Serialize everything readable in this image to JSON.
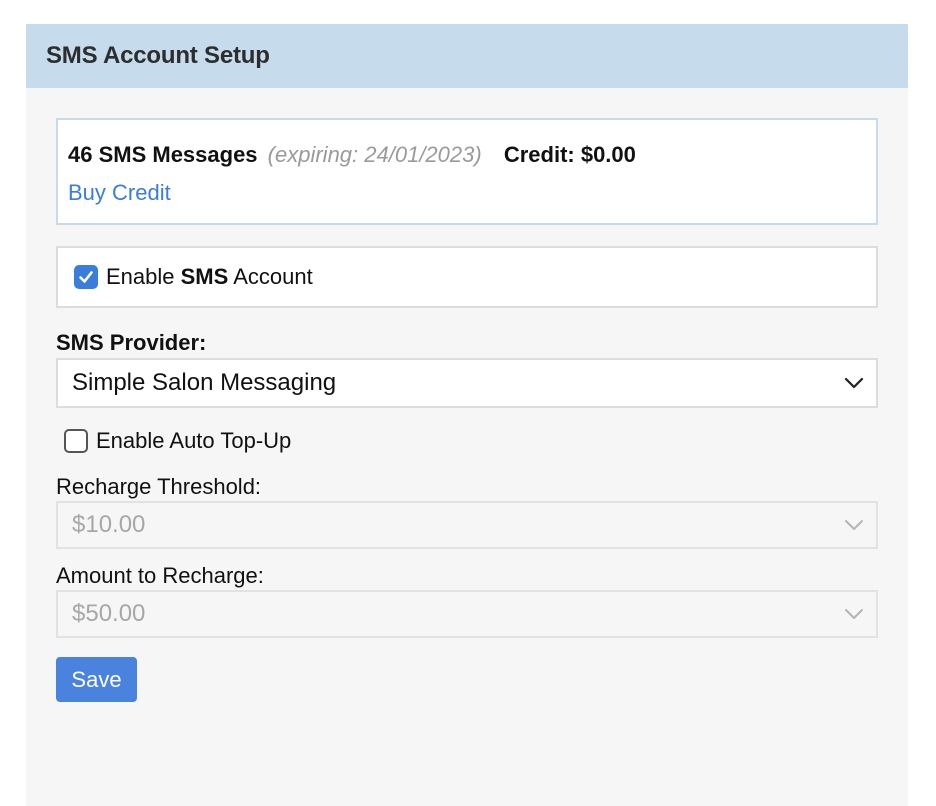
{
  "header": {
    "title": "SMS Account Setup"
  },
  "credit": {
    "messages": "46 SMS Messages",
    "expiring": "(expiring: 24/01/2023)",
    "credit_label": "Credit: $0.00",
    "buy_link": "Buy Credit"
  },
  "enable_sms": {
    "prefix": "Enable ",
    "strong": "SMS",
    "suffix": " Account",
    "checked": true
  },
  "provider": {
    "label": "SMS Provider:",
    "value": "Simple Salon Messaging"
  },
  "auto_topup": {
    "label": "Enable Auto Top-Up",
    "checked": false
  },
  "threshold": {
    "label": "Recharge Threshold:",
    "value": "$10.00"
  },
  "recharge": {
    "label": "Amount to Recharge:",
    "value": "$50.00"
  },
  "save_label": "Save",
  "colors": {
    "accent": "#3b7ddd",
    "header_bg": "#c6dcec",
    "link": "#3b7dd8"
  }
}
